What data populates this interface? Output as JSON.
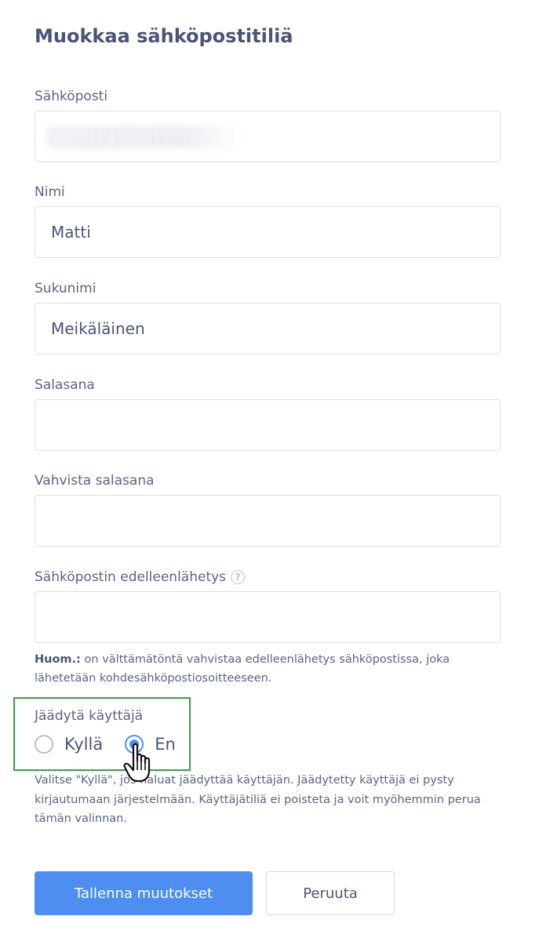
{
  "page": {
    "title": "Muokkaa sähköpostitiliä"
  },
  "form": {
    "email": {
      "label": "Sähköposti",
      "value": ""
    },
    "first_name": {
      "label": "Nimi",
      "value": "Matti"
    },
    "last_name": {
      "label": "Sukunimi",
      "value": "Meikäläinen"
    },
    "password": {
      "label": "Salasana",
      "value": ""
    },
    "password_confirm": {
      "label": "Vahvista salasana",
      "value": ""
    },
    "forwarding": {
      "label": "Sähköpostin edelleenlähetys",
      "help_icon": "question-circle-icon",
      "value": "",
      "note_strong": "Huom.:",
      "note_text": " on välttämätöntä vahvistaa edelleenlähetys sähköpostissa, joka lähetetään kohdesähköpostiosoitteeseen."
    },
    "freeze_user": {
      "label": "Jäädytä käyttäjä",
      "options": [
        {
          "label": "Kyllä",
          "checked": false
        },
        {
          "label": "En",
          "checked": true
        }
      ],
      "description": "Valitse \"Kyllä\", jos haluat jäädyttää käyttäjän. Jäädytetty käyttäjä ei pysty kirjautumaan järjestelmään. Käyttäjätiliä ei poisteta ja voit myöhemmin perua tämän valinnan."
    }
  },
  "actions": {
    "save_label": "Tallenna muutokset",
    "cancel_label": "Peruuta"
  },
  "colors": {
    "accent": "#4d8ef0",
    "text": "#4a5478",
    "highlight": "#3aa048"
  },
  "cursor_icon": "hand-pointer-icon"
}
